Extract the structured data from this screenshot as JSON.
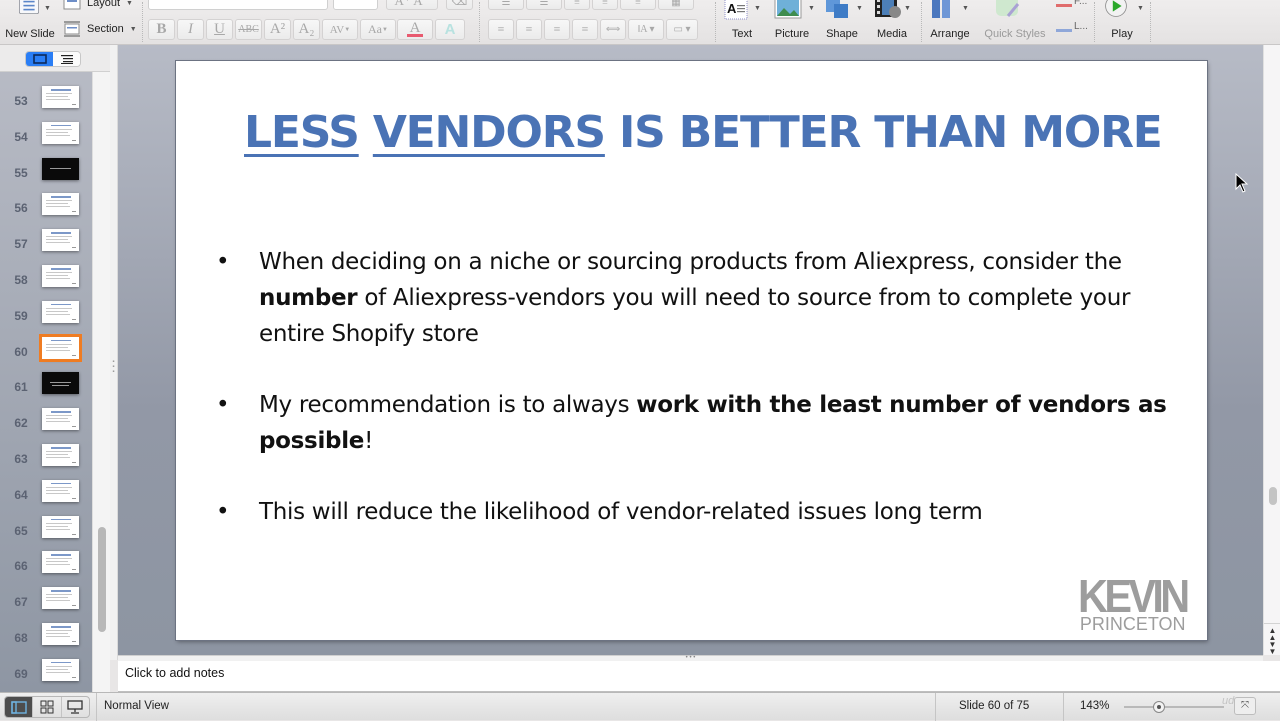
{
  "ribbon": {
    "new_slide_label": "New Slide",
    "layout_label": "Layout",
    "section_label": "Section",
    "format_buttons": [
      "B",
      "I",
      "U",
      "ABC",
      "A²",
      "A₂",
      "AV",
      "Aa",
      "A",
      "A"
    ],
    "insert_buttons": [
      {
        "label": "Text",
        "icon": "text-box-icon"
      },
      {
        "label": "Picture",
        "icon": "picture-icon"
      },
      {
        "label": "Shape",
        "icon": "shape-icon"
      },
      {
        "label": "Media",
        "icon": "media-icon"
      }
    ],
    "arrange_label": "Arrange",
    "quick_styles_label": "Quick Styles",
    "fill_label": "F...",
    "line_label": "L...",
    "play_label": "Play"
  },
  "thumbnails": {
    "view_toggle": [
      "slides-view",
      "outline-view"
    ],
    "items": [
      {
        "number": "53",
        "style": "light"
      },
      {
        "number": "54",
        "style": "light"
      },
      {
        "number": "55",
        "style": "dark"
      },
      {
        "number": "56",
        "style": "light"
      },
      {
        "number": "57",
        "style": "light"
      },
      {
        "number": "58",
        "style": "light"
      },
      {
        "number": "59",
        "style": "light"
      },
      {
        "number": "60",
        "style": "light",
        "selected": true
      },
      {
        "number": "61",
        "style": "dark"
      },
      {
        "number": "62",
        "style": "light"
      },
      {
        "number": "63",
        "style": "light"
      },
      {
        "number": "64",
        "style": "light"
      },
      {
        "number": "65",
        "style": "light"
      },
      {
        "number": "66",
        "style": "light"
      },
      {
        "number": "67",
        "style": "light"
      },
      {
        "number": "68",
        "style": "light"
      },
      {
        "number": "69",
        "style": "light"
      }
    ]
  },
  "slide": {
    "title_part1": "LESS",
    "title_part2": "VENDORS",
    "title_part3": " IS BETTER THAN MORE",
    "title_color": "#4a73b5",
    "bullets": [
      {
        "pre": "When deciding on a niche or sourcing products from Aliexpress, consider the ",
        "bold": "number",
        "post": " of Aliexpress-vendors you will need to source from to complete your entire Shopify store"
      },
      {
        "pre": "My recommendation is to always ",
        "bold": "work with the least number of vendors as possible",
        "post": "!"
      },
      {
        "pre": "This will reduce the likelihood of vendor-related issues long term",
        "bold": "",
        "post": ""
      }
    ],
    "bullet_char": "•",
    "logo_line1": "KEVIN",
    "logo_line2": "PRINCETON"
  },
  "notes": {
    "placeholder": "Click to add notes"
  },
  "status_bar": {
    "view_name": "Normal View",
    "slide_info": "Slide 60 of 75",
    "zoom": "143%",
    "zoom_slider_fraction": 0.35,
    "selected_thumb_color": "#ef7c22"
  }
}
